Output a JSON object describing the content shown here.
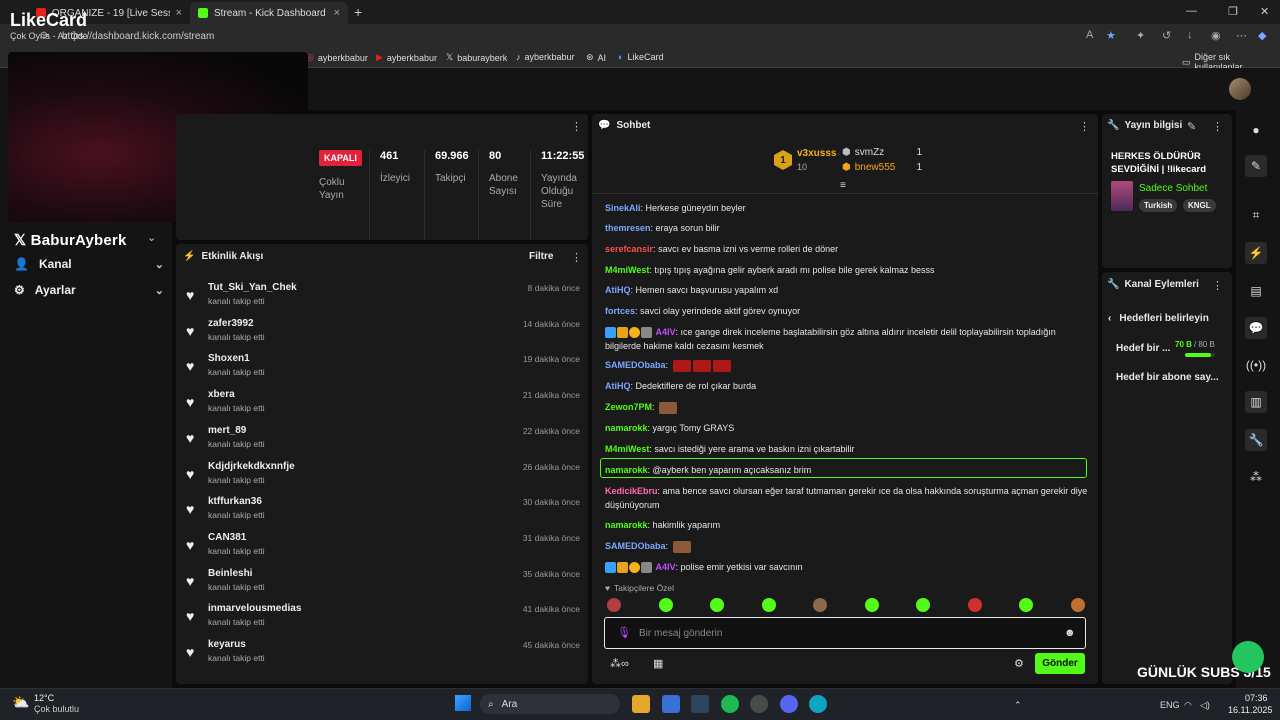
{
  "browser": {
    "tabs": [
      {
        "label": "ORGANIZE - 19 [Live Session] (p...",
        "active": false
      },
      {
        "label": "Stream - Kick Dashboard",
        "active": true
      }
    ],
    "url": "https://dashboard.kick.com/stream",
    "bookmarks": [
      "ayberkbabur",
      "ayberkbabur",
      "baburayberk",
      "ayberkbabur",
      "AI",
      "LikeCard"
    ],
    "other_bookmarks": "Diğer sık kullanılanlar"
  },
  "overlay": {
    "logo": "LikeCard",
    "logo_sub": "Çok Oyna - Az Öde",
    "streamer": "BaburAyberk"
  },
  "leftnav": {
    "items": [
      {
        "label": "Kanal"
      },
      {
        "label": "Ayarlar"
      }
    ]
  },
  "stats": {
    "status": "KAPALI",
    "multistream": "Çoklu Yayın",
    "items": [
      {
        "value": "461",
        "label": "İzleyici"
      },
      {
        "value": "69.966",
        "label": "Takipçi"
      },
      {
        "value": "80",
        "label": "Abone Sayısı"
      },
      {
        "value": "11:22:55",
        "label": "Yayında Olduğu Süre"
      }
    ]
  },
  "activity": {
    "title": "Etkinlik Akışı",
    "filter": "Filtre",
    "items": [
      {
        "name": "Tut_Ski_Yan_Chek",
        "sub": "kanalı takip etti",
        "time": "8 dakika önce"
      },
      {
        "name": "zafer3992",
        "sub": "kanalı takip etti",
        "time": "14 dakika önce"
      },
      {
        "name": "Shoxen1",
        "sub": "kanalı takip etti",
        "time": "19 dakika önce"
      },
      {
        "name": "xbera",
        "sub": "kanalı takip etti",
        "time": "21 dakika önce"
      },
      {
        "name": "mert_89",
        "sub": "kanalı takip etti",
        "time": "22 dakika önce"
      },
      {
        "name": "Kdjdjrkekdkxnnfje",
        "sub": "kanalı takip etti",
        "time": "26 dakika önce"
      },
      {
        "name": "ktffurkan36",
        "sub": "kanalı takip etti",
        "time": "30 dakika önce"
      },
      {
        "name": "CAN381",
        "sub": "kanalı takip etti",
        "time": "31 dakika önce"
      },
      {
        "name": "Beinleshi",
        "sub": "kanalı takip etti",
        "time": "35 dakika önce"
      },
      {
        "name": "inmarvelousmedias",
        "sub": "kanalı takip etti",
        "time": "41 dakika önce"
      },
      {
        "name": "keyarus",
        "sub": "kanalı takip etti",
        "time": "45 dakika önce"
      }
    ]
  },
  "chat": {
    "title": "Sohbet",
    "leader": {
      "rank": "1",
      "name": "v3xusss",
      "count": "10"
    },
    "others": [
      {
        "name": "svmZz",
        "count": "1"
      },
      {
        "name": "bnew555",
        "count": "1"
      }
    ],
    "messages": [
      {
        "user": "SinekAli",
        "color": "#7aa8ff",
        "text": "Herkese güneydın beyler"
      },
      {
        "user": "themresen",
        "color": "#7aa8ff",
        "text": "eraya sorun bilir"
      },
      {
        "user": "serefcansir",
        "color": "#ff4d4d",
        "text": "savcı ev basma izni vs verme rolleri de döner"
      },
      {
        "user": "M4miWest",
        "color": "#53fc18",
        "text": "tıpış tıpış ayağına gelir ayberk aradı mı polise bile gerek kalmaz besss"
      },
      {
        "user": "AtiHQ",
        "color": "#7aa8ff",
        "text": "Hemen savcı başvurusu yapalım xd"
      },
      {
        "user": "fortces",
        "color": "#7aa8ff",
        "text": "savci olay yerindede aktif görev oynuyor"
      },
      {
        "user": "A4IV",
        "color": "#c04dff",
        "text": "ıce gange direk inceleme başlatabilirsin göz altına aldırır inceletir delil toplayabilirsin topladığın bilgilerde hakime kaldı cezasını kesmek"
      },
      {
        "user": "SAMEDObaba",
        "color": "#7aa8ff",
        "text": ""
      },
      {
        "user": "AtiHQ",
        "color": "#7aa8ff",
        "text": "Dedektiflere de rol çıkar burda"
      },
      {
        "user": "Zewon7PM",
        "color": "#53fc18",
        "text": ""
      },
      {
        "user": "namarokk",
        "color": "#53fc18",
        "text": "yargıç Tomy GRAYS"
      },
      {
        "user": "M4miWest",
        "color": "#53fc18",
        "text": "savcı istediği yere arama ve baskın izni çıkartabilir"
      },
      {
        "user": "namarokk",
        "color": "#53fc18",
        "text": "@ayberk ben yaparım açıcaksanız brim"
      },
      {
        "user": "KedicikEbru",
        "color": "#ff6bb0",
        "text": "ama bence savcı olursan eğer taraf tutmaman gerekir ıce da olsa hakkında soruşturma açman gerekir diye düşünüyorum"
      },
      {
        "user": "namarokk",
        "color": "#53fc18",
        "text": "hakimlik yaparım"
      },
      {
        "user": "SAMEDObaba",
        "color": "#7aa8ff",
        "text": ""
      },
      {
        "user": "A4IV",
        "color": "#c04dff",
        "text": "polise emir yetkisi var savcının"
      }
    ],
    "followers_only": "Takipçilere Özel",
    "input_placeholder": "Bir mesaj gönderin",
    "send": "Gönder"
  },
  "info": {
    "title": "Yayın bilgisi",
    "stream_title": "HERKES ÖLDÜRÜR SEVDİĞİNİ | !likecard",
    "category": "Sadece Sohbet",
    "tags": [
      "Turkish",
      "KNGL"
    ]
  },
  "actions": {
    "title": "Kanal Eylemleri",
    "back": "Hedefleri belirleyin",
    "goal1": "Hedef bir ...",
    "goal1_progress": "70 B",
    "goal1_total": "/ 80 B",
    "goal1_fraction": 0.875,
    "goal2": "Hedef bir abone say..."
  },
  "subs_overlay": "GÜNLÜK SUBS 3/15",
  "taskbar": {
    "weather_temp": "12°C",
    "weather_desc": "Çok bulutlu",
    "search": "Ara",
    "lang": "ENG",
    "time": "07:36",
    "date": "16.11.2025"
  },
  "colors": {
    "accent": "#53fc18",
    "kapali": "#e0223a"
  }
}
